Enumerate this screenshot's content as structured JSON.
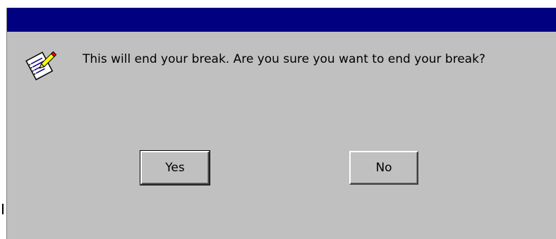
{
  "dialog": {
    "message": "This will end your break. Are you sure you want to end your break?",
    "icon": "notepad-pencil-icon",
    "titlebar_color": "#000080",
    "background_color": "#c0c0c0"
  },
  "buttons": {
    "yes_label": "Yes",
    "no_label": "No"
  }
}
